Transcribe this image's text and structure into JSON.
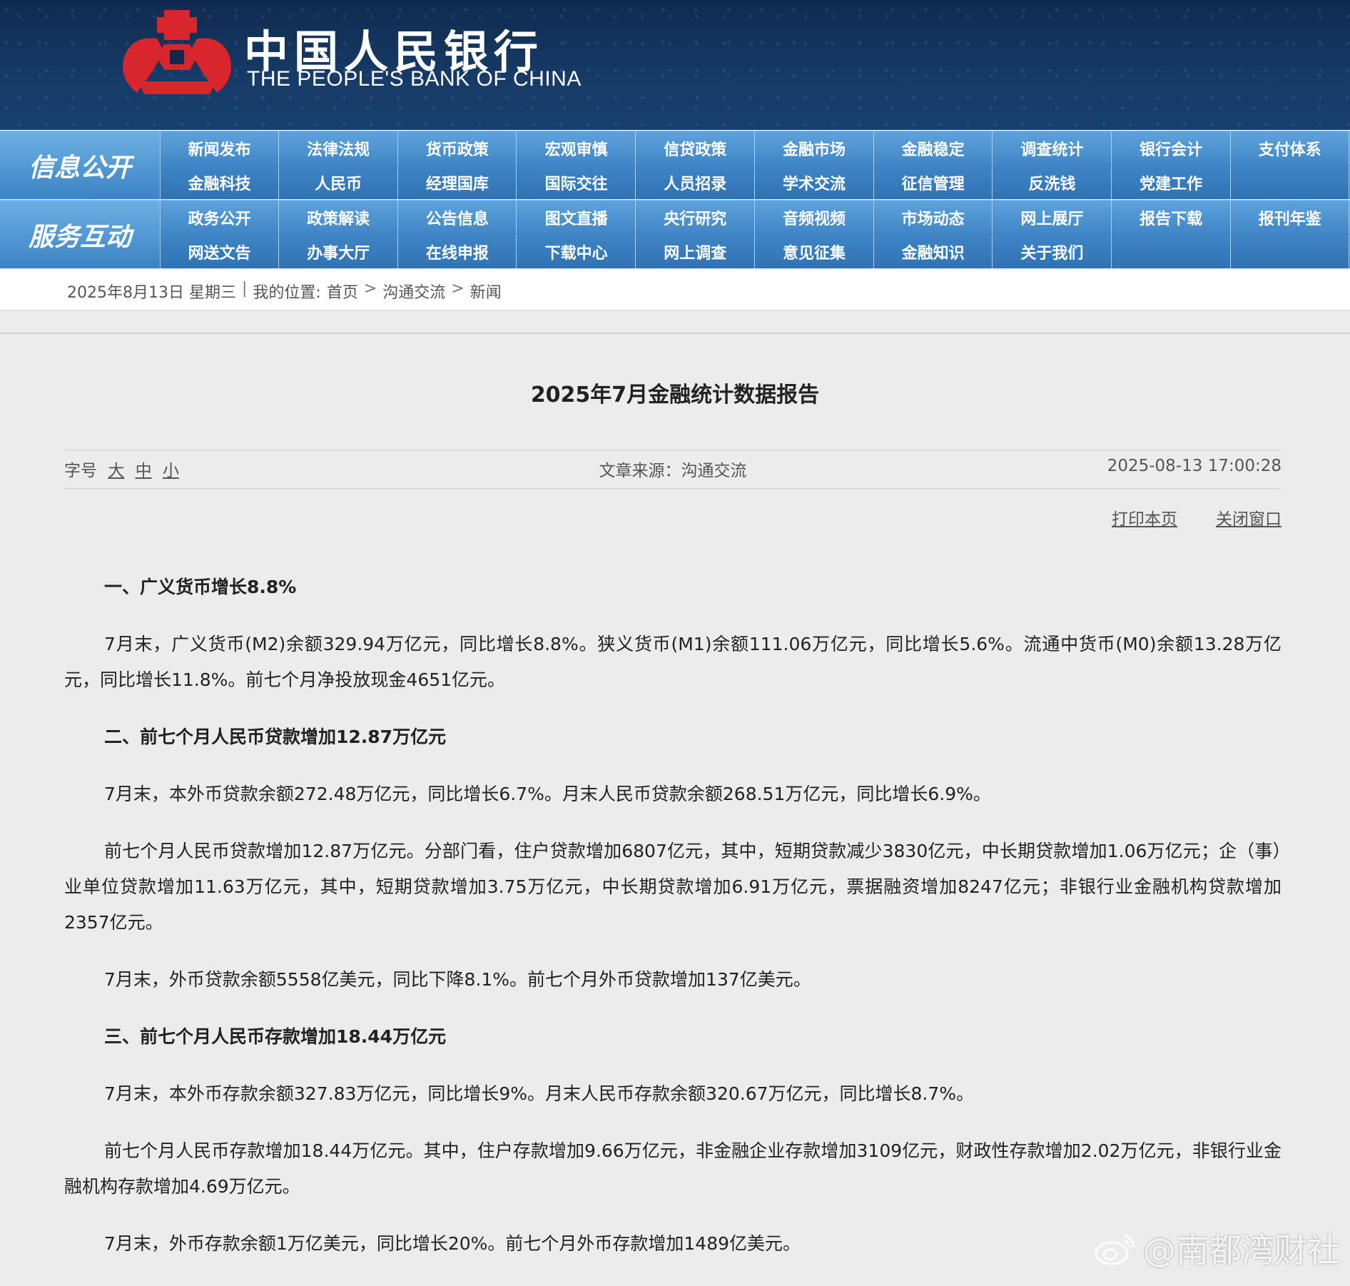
{
  "header": {
    "bank_name_cn": "中国人民银行",
    "bank_name_en": "THE PEOPLE'S BANK OF CHINA",
    "logo_color": "#d9262c"
  },
  "nav": {
    "info_label": "信息公开",
    "service_label": "服务互动",
    "info_items": [
      "新闻发布",
      "法律法规",
      "货币政策",
      "宏观审慎",
      "信贷政策",
      "金融市场",
      "金融稳定",
      "调查统计",
      "银行会计",
      "支付体系",
      "金融科技",
      "人民币",
      "经理国库",
      "国际交往",
      "人员招录",
      "学术交流",
      "征信管理",
      "反洗钱",
      "党建工作"
    ],
    "service_items": [
      "政务公开",
      "政策解读",
      "公告信息",
      "图文直播",
      "央行研究",
      "音频视频",
      "市场动态",
      "网上展厅",
      "报告下载",
      "报刊年鉴",
      "网送文告",
      "办事大厅",
      "在线申报",
      "下载中心",
      "网上调查",
      "意见征集",
      "金融知识",
      "关于我们"
    ]
  },
  "breadcrumb": {
    "date": "2025年8月13日 星期三",
    "divider": "|",
    "location_label": "我的位置:",
    "items": [
      "首页",
      "沟通交流",
      "新闻"
    ],
    "separator": ">"
  },
  "article": {
    "title": "2025年7月金融统计数据报告",
    "font_size_label": "字号",
    "font_sizes": [
      "大",
      "中",
      "小"
    ],
    "source": "文章来源：沟通交流",
    "datetime": "2025-08-13 17:00:28",
    "print_label": "打印本页",
    "close_label": "关闭窗口",
    "blocks": [
      {
        "type": "h",
        "text": "一、广义货币增长8.8%"
      },
      {
        "type": "p",
        "text": "7月末，广义货币(M2)余额329.94万亿元，同比增长8.8%。狭义货币(M1)余额111.06万亿元，同比增长5.6%。流通中货币(M0)余额13.28万亿元，同比增长11.8%。前七个月净投放现金4651亿元。"
      },
      {
        "type": "h",
        "text": "二、前七个月人民币贷款增加12.87万亿元"
      },
      {
        "type": "p",
        "text": "7月末，本外币贷款余额272.48万亿元，同比增长6.7%。月末人民币贷款余额268.51万亿元，同比增长6.9%。"
      },
      {
        "type": "p",
        "text": "前七个月人民币贷款增加12.87万亿元。分部门看，住户贷款增加6807亿元，其中，短期贷款减少3830亿元，中长期贷款增加1.06万亿元；企（事）业单位贷款增加11.63万亿元，其中，短期贷款增加3.75万亿元，中长期贷款增加6.91万亿元，票据融资增加8247亿元；非银行业金融机构贷款增加2357亿元。"
      },
      {
        "type": "p",
        "text": "7月末，外币贷款余额5558亿美元，同比下降8.1%。前七个月外币贷款增加137亿美元。"
      },
      {
        "type": "h",
        "text": "三、前七个月人民币存款增加18.44万亿元"
      },
      {
        "type": "p",
        "text": "7月末，本外币存款余额327.83万亿元，同比增长9%。月末人民币存款余额320.67万亿元，同比增长8.7%。"
      },
      {
        "type": "p",
        "text": "前七个月人民币存款增加18.44万亿元。其中，住户存款增加9.66万亿元，非金融企业存款增加3109亿元，财政性存款增加2.02万亿元，非银行业金融机构存款增加4.69万亿元。"
      },
      {
        "type": "p",
        "text": "7月末，外币存款余额1万亿美元，同比增长20%。前七个月外币存款增加1489亿美元。"
      }
    ]
  },
  "watermark": {
    "text": "@南都湾财社",
    "icon": "weibo-icon"
  }
}
